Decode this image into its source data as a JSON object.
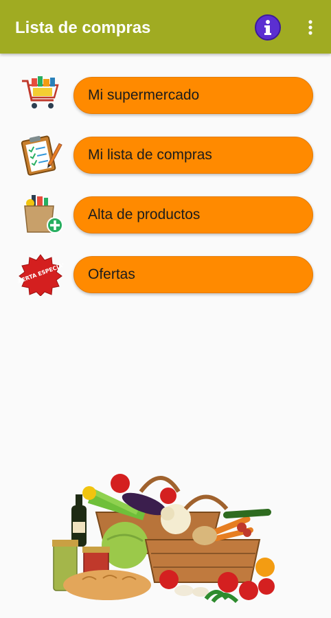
{
  "app_bar": {
    "title": "Lista de compras",
    "background": "#a0ab22",
    "info_icon": "info-icon",
    "overflow_icon": "more-vert-icon"
  },
  "menu": {
    "button_color": "#ff8a00",
    "items": [
      {
        "label": "Mi supermercado",
        "icon": "shopping-cart-icon"
      },
      {
        "label": "Mi lista de compras",
        "icon": "clipboard-checklist-icon"
      },
      {
        "label": "Alta de productos",
        "icon": "grocery-bag-add-icon"
      },
      {
        "label": "Ofertas",
        "icon": "special-offer-badge-icon",
        "badge_text": "OFERTA ESPECIAL"
      }
    ]
  },
  "illustration": {
    "icon": "vegetable-basket-illustration"
  }
}
